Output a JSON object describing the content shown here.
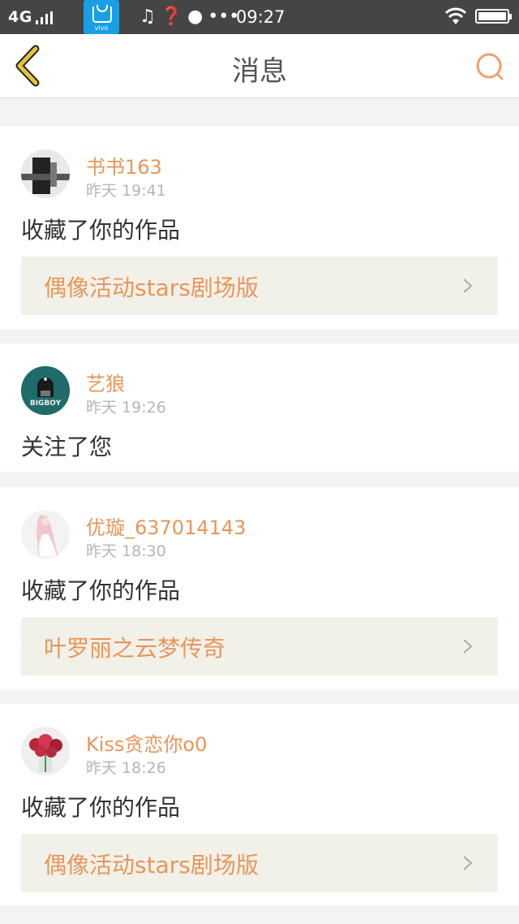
{
  "status_bar": {
    "network": "4G",
    "app_badge": "vivo",
    "icons": [
      "music-note-icon",
      "question-icon",
      "palette-icon",
      "more-dots-icon"
    ],
    "time": "09:27"
  },
  "header": {
    "title": "消息",
    "back_icon": "chevron-left-icon",
    "search_icon": "search-icon"
  },
  "messages": [
    {
      "user": "书书163",
      "time": "昨天 19:41",
      "action": "收藏了你的作品",
      "work": "偶像活动stars剧场版"
    },
    {
      "user": "艺狼",
      "avatar_text": "BIGBOY",
      "time": "昨天 19:26",
      "action": "关注了您"
    },
    {
      "user": "优璇_637014143",
      "time": "昨天 18:30",
      "action": "收藏了你的作品",
      "work": "叶罗丽之云梦传奇"
    },
    {
      "user": "Kiss贪恋你o0",
      "time": "昨天 18:26",
      "action": "收藏了你的作品",
      "work": "偶像活动stars剧场版"
    }
  ],
  "colors": {
    "accent": "#e8965a",
    "status_bar": "#454545",
    "work_bg": "#f2f1e9",
    "back_icon": "#e8c23a"
  }
}
